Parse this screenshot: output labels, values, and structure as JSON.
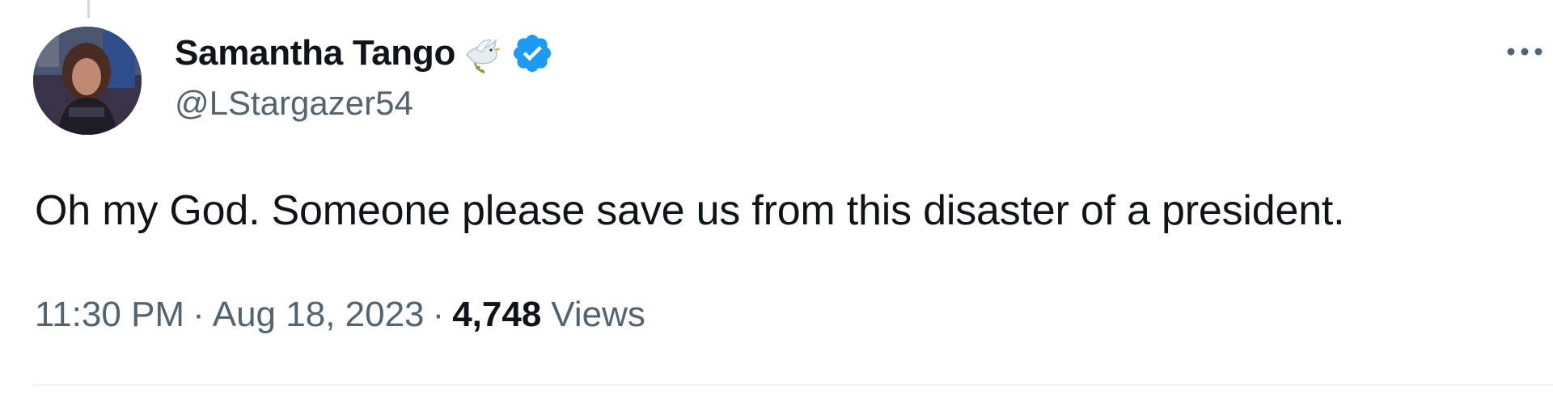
{
  "author": {
    "display_name": "Samantha Tango",
    "handle": "@LStargazer54",
    "name_emoji": "dove-of-peace-emoji",
    "verified": true,
    "verified_color": "#1d9bf0"
  },
  "tweet": {
    "text": "Oh my God. Someone please save us from this disaster of a president.",
    "time": "11:30 PM",
    "separator": "·",
    "date": "Aug 18, 2023",
    "views_count": "4,748",
    "views_label": "Views"
  },
  "icons": {
    "more": "more-horizontal-icon",
    "verified": "verified-badge-icon"
  },
  "colors": {
    "text_primary": "#0f1419",
    "text_secondary": "#536471",
    "divider": "#eff3f4",
    "thread_line": "#cfd9de"
  }
}
